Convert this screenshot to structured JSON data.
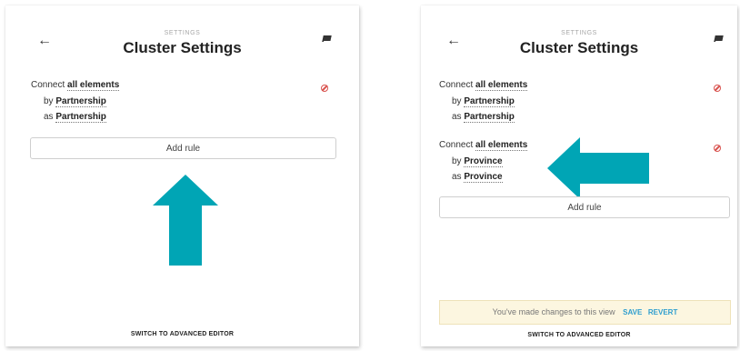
{
  "left_panel": {
    "kicker": "SETTINGS",
    "title": "Cluster Settings",
    "back_icon": "back-arrow-icon",
    "docs_icon": "book-icon",
    "rules": [
      {
        "connect_word": "Connect",
        "target": "all elements",
        "by_word": "by",
        "by_value": "Partnership",
        "as_word": "as",
        "as_value": "Partnership"
      }
    ],
    "add_rule_label": "Add rule",
    "advanced_editor_label": "SWITCH TO ADVANCED EDITOR"
  },
  "right_panel": {
    "kicker": "SETTINGS",
    "title": "Cluster Settings",
    "back_icon": "back-arrow-icon",
    "docs_icon": "book-icon",
    "rules": [
      {
        "connect_word": "Connect",
        "target": "all elements",
        "by_word": "by",
        "by_value": "Partnership",
        "as_word": "as",
        "as_value": "Partnership"
      },
      {
        "connect_word": "Connect",
        "target": "all elements",
        "by_word": "by",
        "by_value": "Province",
        "as_word": "as",
        "as_value": "Province"
      }
    ],
    "add_rule_label": "Add rule",
    "changes_message": "You've made changes to this view",
    "save_label": "SAVE",
    "revert_label": "REVERT",
    "advanced_editor_label": "SWITCH TO ADVANCED EDITOR"
  },
  "colors": {
    "annotation_arrow": "#00a5b5",
    "delete_icon": "#d9534f",
    "action_link": "#2e9ecf",
    "notice_bg": "#fcf6e0"
  }
}
